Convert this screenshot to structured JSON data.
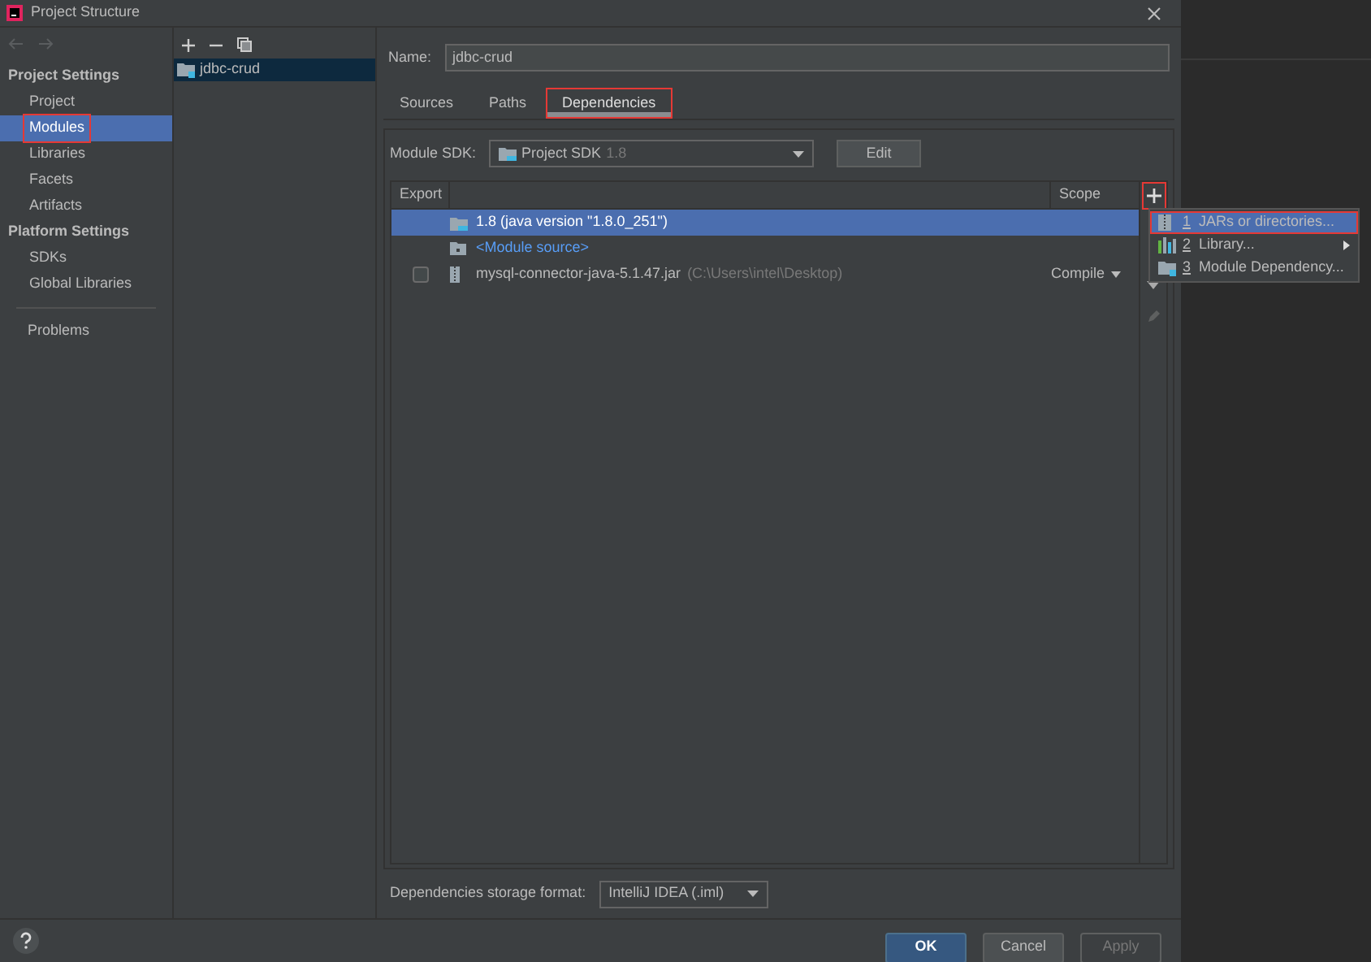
{
  "window": {
    "title": "Project Structure"
  },
  "sidebar": {
    "sections": [
      {
        "heading": "Project Settings",
        "items": [
          {
            "label": "Project",
            "selected": false,
            "highlighted": false
          },
          {
            "label": "Modules",
            "selected": true,
            "highlighted": true
          },
          {
            "label": "Libraries",
            "selected": false,
            "highlighted": false
          },
          {
            "label": "Facets",
            "selected": false,
            "highlighted": false
          },
          {
            "label": "Artifacts",
            "selected": false,
            "highlighted": false
          }
        ]
      },
      {
        "heading": "Platform Settings",
        "items": [
          {
            "label": "SDKs",
            "selected": false,
            "highlighted": false
          },
          {
            "label": "Global Libraries",
            "selected": false,
            "highlighted": false
          }
        ]
      }
    ],
    "bottom_items": [
      {
        "label": "Problems",
        "selected": false
      }
    ]
  },
  "module_list": {
    "items": [
      {
        "label": "jdbc-crud",
        "selected": true
      }
    ]
  },
  "name_field": {
    "label": "Name:",
    "value": "jdbc-crud"
  },
  "tabs": [
    {
      "label": "Sources",
      "selected": false,
      "highlighted": false
    },
    {
      "label": "Paths",
      "selected": false,
      "highlighted": false
    },
    {
      "label": "Dependencies",
      "selected": true,
      "highlighted": true
    }
  ],
  "module_sdk": {
    "label": "Module SDK:",
    "value": "Project SDK",
    "version": "1.8",
    "button": "Edit"
  },
  "table": {
    "columns": [
      "Export",
      "Scope"
    ],
    "rows": [
      {
        "kind": "sdk",
        "name": "1.8 (java version \"1.8.0_251\")",
        "selected": true
      },
      {
        "kind": "source",
        "name": "<Module source>",
        "selected": false
      },
      {
        "kind": "jar",
        "name": "mysql-connector-java-5.1.47.jar",
        "path": "(C:\\Users\\intel\\Desktop)",
        "scope": "Compile",
        "checked": false,
        "selected": false
      }
    ]
  },
  "add_button": {
    "highlighted": true
  },
  "add_menu": {
    "items": [
      {
        "kind": "jars",
        "number": "1",
        "label": "JARs or directories...",
        "selected": true,
        "highlighted": true,
        "submenu": false
      },
      {
        "kind": "library",
        "number": "2",
        "label": "Library...",
        "selected": false,
        "highlighted": false,
        "submenu": true
      },
      {
        "kind": "module",
        "number": "3",
        "label": "Module Dependency...",
        "selected": false,
        "highlighted": false,
        "submenu": false
      }
    ]
  },
  "storage_format": {
    "label": "Dependencies storage format:",
    "value": "IntelliJ IDEA (.iml)"
  },
  "buttons": [
    {
      "label": "OK",
      "kind": "primary"
    },
    {
      "label": "Cancel",
      "kind": "normal"
    },
    {
      "label": "Apply",
      "kind": "disabled"
    }
  ]
}
